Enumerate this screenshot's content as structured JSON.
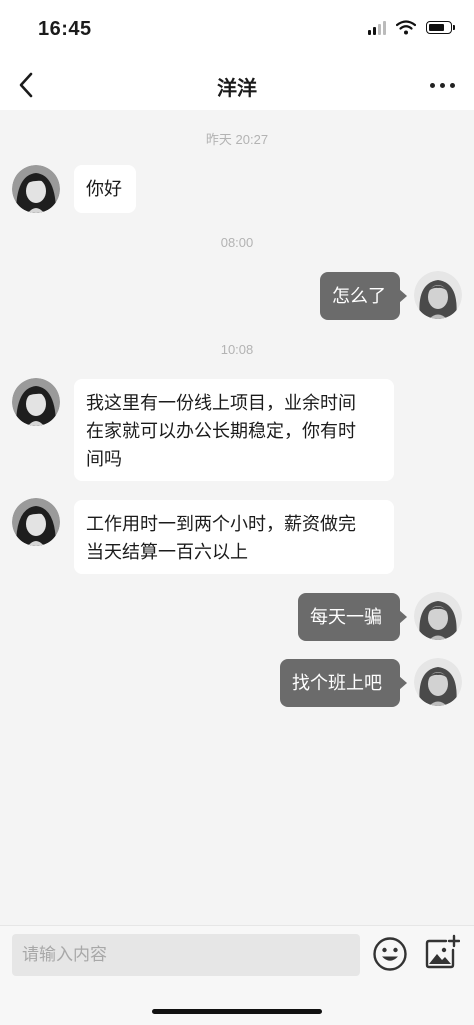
{
  "status_bar": {
    "time": "16:45",
    "icons": [
      "signal-icon",
      "wifi-icon",
      "battery-icon"
    ]
  },
  "nav": {
    "title": "洋洋",
    "back_icon": "chevron-left-icon",
    "more_icon": "more-dots-icon"
  },
  "messages": {
    "timestamps": [
      "昨天 20:27",
      "08:00",
      "10:08"
    ],
    "m1": "你好",
    "m2": "怎么了",
    "m3": "我这里有一份线上项目，业余时间\n在家就可以办公长期稳定，你有时\n间吗",
    "m4": "工作用时一到两个小时，薪资做完\n当天结算一百六以上",
    "m5": "每天一骗",
    "m6": "找个班上吧"
  },
  "input": {
    "placeholder": "请输入内容",
    "value": "",
    "emoji_icon": "emoji-icon",
    "image_icon": "image-add-icon"
  },
  "colors": {
    "outgoing_bubble": "#6b6b6b",
    "incoming_bubble": "#ffffff",
    "chat_background": "#f4f4f4",
    "timestamp_text": "#b3b3b3"
  }
}
